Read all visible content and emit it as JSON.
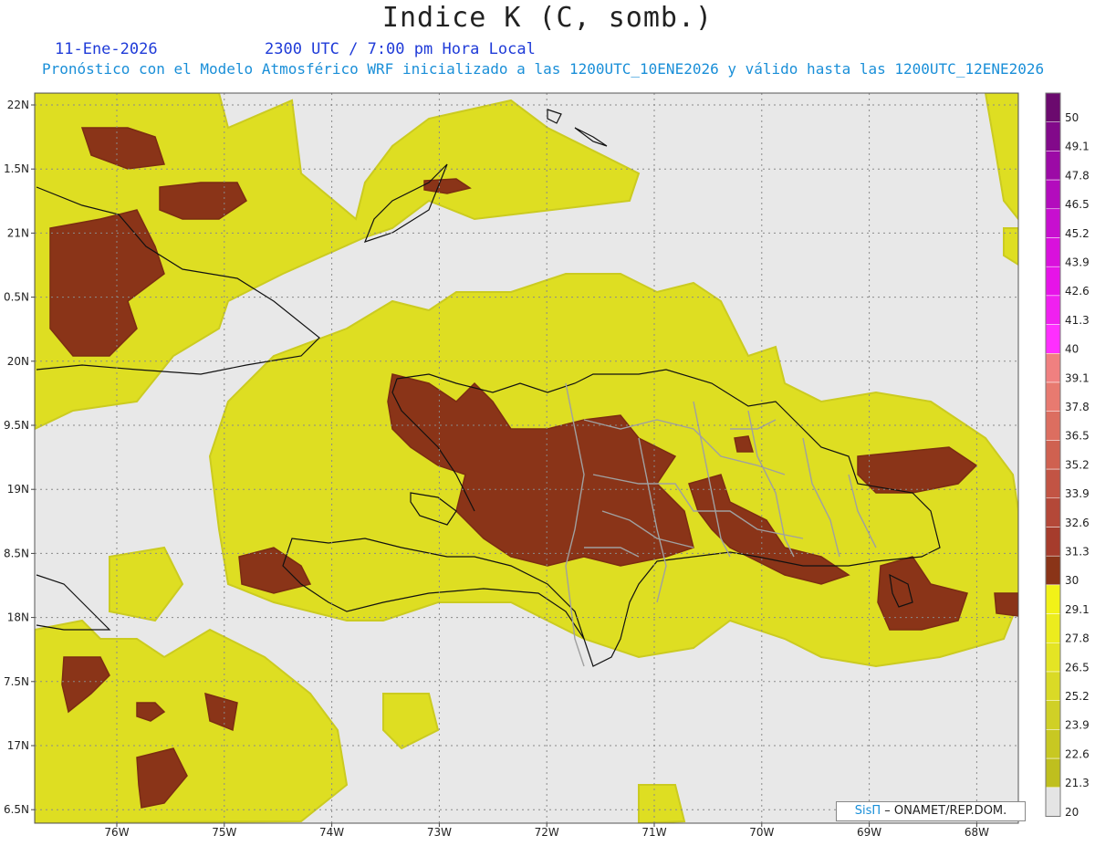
{
  "header": {
    "title": "Indice K (C, somb.)",
    "date": "11-Ene-2026",
    "time": "2300 UTC / 7:00 pm Hora Local",
    "subtitle": "Pronóstico con el Modelo Atmosférico WRF inicializado a las 1200UTC_10ENE2026 y válido hasta las  1200UTC_12ENE2026"
  },
  "map": {
    "lat_labels": [
      "22N",
      "1.5N",
      "21N",
      "0.5N",
      "20N",
      "9.5N",
      "19N",
      "8.5N",
      "18N",
      "7.5N",
      "17N",
      "6.5N"
    ],
    "lon_labels": [
      "76W",
      "75W",
      "74W",
      "73W",
      "72W",
      "71W",
      "70W",
      "69W",
      "68W"
    ],
    "background_color": "#e8e8e8"
  },
  "legend": {
    "labels": [
      "50",
      "49.1",
      "47.8",
      "46.5",
      "45.2",
      "43.9",
      "42.6",
      "41.3",
      "40",
      "39.1",
      "37.8",
      "36.5",
      "35.2",
      "33.9",
      "32.6",
      "31.3",
      "30",
      "29.1",
      "27.8",
      "26.5",
      "25.2",
      "23.9",
      "22.6",
      "21.3",
      "20"
    ],
    "colors": [
      "#6b0a6e",
      "#82098a",
      "#9c0aa6",
      "#b30cbd",
      "#c70fcf",
      "#d911dc",
      "#e614e8",
      "#f020f0",
      "#ff2fff",
      "#f08080",
      "#e87a70",
      "#dc6e60",
      "#cf6150",
      "#c25444",
      "#b44838",
      "#a63c2c",
      "#8a3418",
      "#f2f218",
      "#ecec1e",
      "#e4e424",
      "#dada26",
      "#d0d026",
      "#c8c822",
      "#bfbf1e",
      "#e4e4e4"
    ]
  },
  "credit": {
    "brand": "SisΠ",
    "text": " – ONAMET/REP.DOM."
  }
}
